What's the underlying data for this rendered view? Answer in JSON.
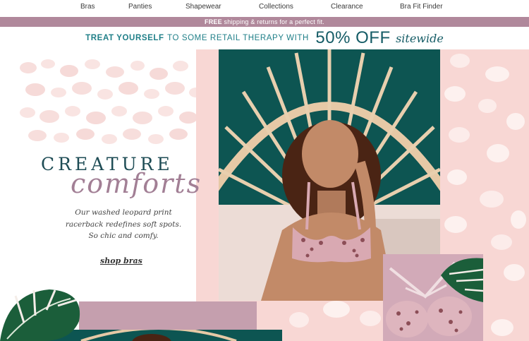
{
  "nav": {
    "items": [
      "Bras",
      "Panties",
      "Shapewear",
      "Collections",
      "Clearance",
      "Bra Fit Finder"
    ]
  },
  "shipping_bar": {
    "bold": "FREE",
    "rest": "shipping & returns for a perfect fit."
  },
  "promo": {
    "part1": "TREAT YOURSELF",
    "part2": "TO SOME RETAIL THERAPY WITH",
    "part3": "50% OFF",
    "part4": "sitewide"
  },
  "hero": {
    "headline_top": "CREATURE",
    "headline_script": "comforts",
    "body_line1": "Our washed leopard print",
    "body_line2": "racerback redefines soft spots.",
    "body_line3": "So chic and comfy.",
    "cta": "shop bras"
  },
  "icons": {
    "leaf_left": "tropical-leaf-icon",
    "leaf_right": "tropical-leaf-icon"
  },
  "colors": {
    "brand_mauve": "#b0889b",
    "promo_teal": "#1f7f88",
    "headline_teal": "#1e4c55",
    "script_mauve": "#a27f95",
    "blush": "#f8d7d4",
    "photo_teal": "#0d5552"
  }
}
